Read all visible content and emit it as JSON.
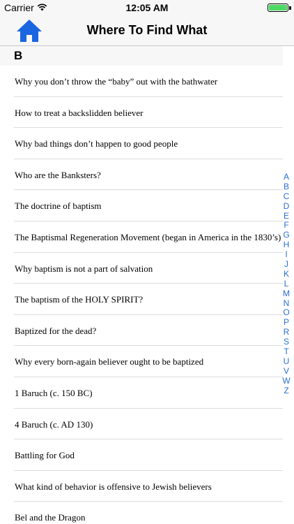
{
  "status_bar": {
    "carrier": "Carrier",
    "time": "12:05 AM",
    "battery_level": 1.0,
    "battery_color": "#4cd964"
  },
  "nav": {
    "title": "Where To Find What",
    "home_icon": "home-icon",
    "accent_color": "#1a66e0"
  },
  "section": {
    "letter": "B"
  },
  "items": [
    {
      "label": "Why you don’t throw the “baby” out with the bathwater"
    },
    {
      "label": "How to treat a backslidden believer"
    },
    {
      "label": "Why bad things don’t happen to good people"
    },
    {
      "label": "Who are the Banksters?"
    },
    {
      "label": "The doctrine of baptism"
    },
    {
      "label": "The Baptismal Regeneration Movement (began in America in the 1830’s)"
    },
    {
      "label": "Why baptism is not a part of salvation"
    },
    {
      "label": "The baptism of the HOLY SPIRIT?"
    },
    {
      "label": "Baptized for the dead?"
    },
    {
      "label": "Why every born-again believer ought to be baptized"
    },
    {
      "label": "1 Baruch (c. 150 BC)"
    },
    {
      "label": "4 Baruch (c. AD 130)"
    },
    {
      "label": "Battling for God"
    },
    {
      "label": "What kind of behavior is offensive to Jewish believers"
    },
    {
      "label": "Bel and the Dragon"
    }
  ],
  "index_letters": [
    "A",
    "B",
    "C",
    "D",
    "E",
    "F",
    "G",
    "H",
    "I",
    "J",
    "K",
    "L",
    "M",
    "N",
    "O",
    "P",
    "R",
    "S",
    "T",
    "U",
    "V",
    "W",
    "Z"
  ]
}
